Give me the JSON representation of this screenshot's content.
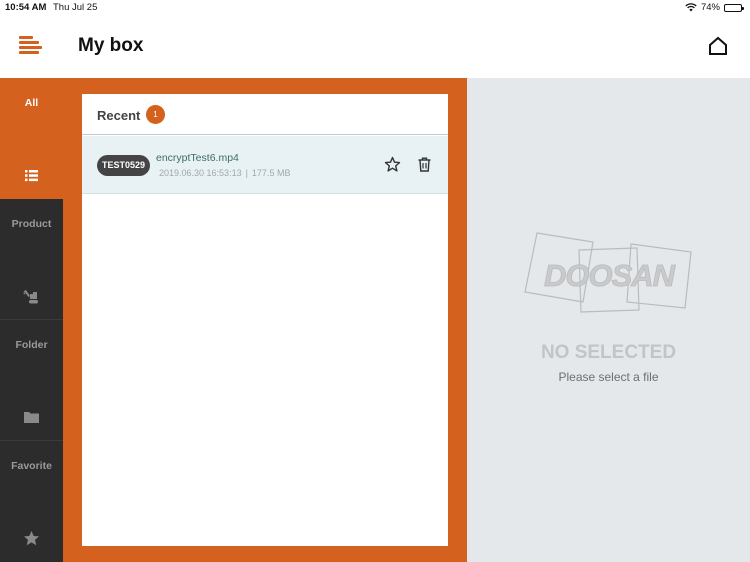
{
  "status_bar": {
    "time": "10:54 AM",
    "date": "Thu Jul 25",
    "battery_percent": "74%",
    "battery_level": 0.74,
    "icons": [
      "wifi-icon",
      "battery-icon"
    ]
  },
  "header": {
    "title": "My box",
    "menu_icon": "menu-icon",
    "home_icon": "home-icon"
  },
  "sidebar": {
    "items": [
      {
        "label": "All",
        "icon": "list-icon",
        "active": true
      },
      {
        "label": "Product",
        "icon": "excavator-icon",
        "active": false
      },
      {
        "label": "Folder",
        "icon": "folder-icon",
        "active": false
      },
      {
        "label": "Favorite",
        "icon": "star-icon",
        "active": false
      }
    ]
  },
  "file_list": {
    "section_title": "Recent",
    "count": "1",
    "files": [
      {
        "tag": "TEST0529",
        "name": "encryptTest6.mp4",
        "date": "2019.06.30 16:53:13",
        "separator": "|",
        "size": "177.5 MB"
      }
    ]
  },
  "detail": {
    "logo_text": "DOOSAN",
    "empty_title": "NO SELECTED",
    "empty_subtitle": "Please select a file"
  },
  "colors": {
    "accent": "#d4621e",
    "sidebar_bg": "#2c2c2c",
    "detail_bg": "#e5e8ea",
    "row_highlight": "#e8f1f4"
  }
}
